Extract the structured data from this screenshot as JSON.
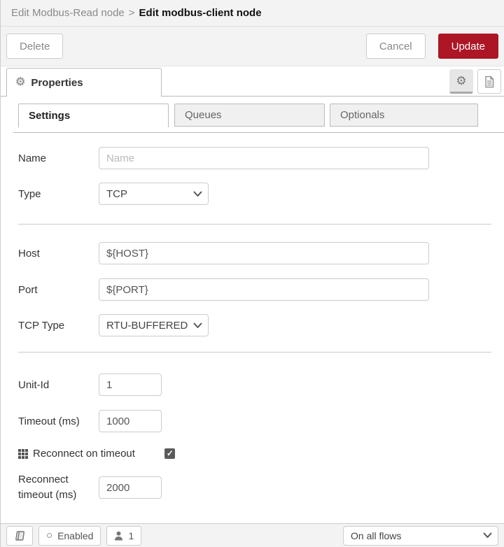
{
  "header": {
    "breadcrumb_parent": "Edit Modbus-Read node",
    "breadcrumb_separator": ">",
    "breadcrumb_current": "Edit modbus-client node"
  },
  "actionbar": {
    "delete_label": "Delete",
    "cancel_label": "Cancel",
    "update_label": "Update"
  },
  "panel": {
    "properties_tab_label": "Properties",
    "icons": [
      "gear-icon",
      "doc-icon"
    ]
  },
  "tabs": [
    {
      "label": "Settings",
      "active": true
    },
    {
      "label": "Queues",
      "active": false
    },
    {
      "label": "Optionals",
      "active": false
    }
  ],
  "form": {
    "name": {
      "label": "Name",
      "placeholder": "Name",
      "value": ""
    },
    "type": {
      "label": "Type",
      "value": "TCP"
    },
    "host": {
      "label": "Host",
      "value": "${HOST}"
    },
    "port": {
      "label": "Port",
      "value": "${PORT}"
    },
    "tcp_type": {
      "label": "TCP Type",
      "value": "RTU-BUFFERED"
    },
    "unit_id": {
      "label": "Unit-Id",
      "value": "1"
    },
    "timeout": {
      "label": "Timeout (ms)",
      "value": "1000"
    },
    "reconnect_on_timeout": {
      "label": "Reconnect on timeout",
      "checked": true
    },
    "reconnect_timeout": {
      "label_line1": "Reconnect",
      "label_line2": "timeout (ms)",
      "value": "2000"
    }
  },
  "footer": {
    "enabled_label": "Enabled",
    "instance_count": "1",
    "scope_select_value": "On all flows"
  },
  "colors": {
    "accent_red": "#AD1625",
    "header_bg": "#f3f3f3",
    "border": "#cccccc"
  }
}
